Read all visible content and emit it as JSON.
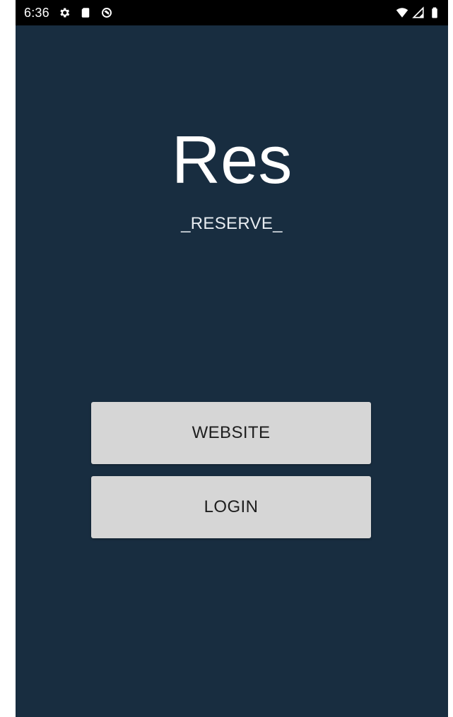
{
  "status_bar": {
    "time": "6:36",
    "left_icons": [
      "gear-icon",
      "sd-card-icon",
      "data-saver-icon"
    ],
    "right_icons": [
      "wifi-icon",
      "cellular-icon",
      "battery-icon"
    ]
  },
  "app": {
    "title": "Res",
    "subtitle": "_RESERVE_"
  },
  "buttons": {
    "website_label": "WEBSITE",
    "login_label": "LOGIN"
  },
  "colors": {
    "background": "#182d40",
    "status_bar": "#000000",
    "button": "#d6d6d6",
    "button_text": "#1e1e1e",
    "title_text": "#ffffff"
  }
}
